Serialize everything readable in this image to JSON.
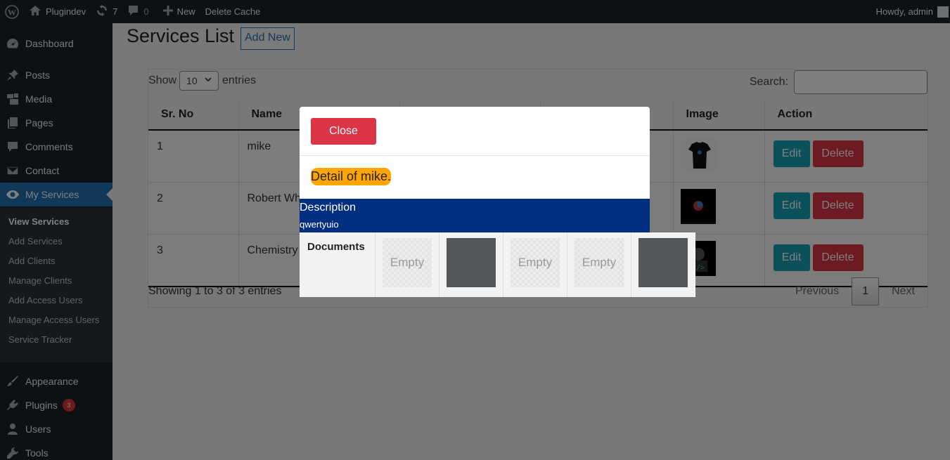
{
  "adminbar": {
    "site_name": "Plugindev",
    "updates_count": "7",
    "comments_count": "0",
    "new_label": "New",
    "delete_cache_label": "Delete Cache",
    "howdy": "Howdy, admin"
  },
  "sidebar": {
    "items": [
      {
        "label": "Dashboard",
        "icon": "dashboard-icon"
      },
      {
        "label": "Posts",
        "icon": "pin-icon"
      },
      {
        "label": "Media",
        "icon": "media-icon"
      },
      {
        "label": "Pages",
        "icon": "pages-icon"
      },
      {
        "label": "Comments",
        "icon": "comment-icon"
      },
      {
        "label": "Contact",
        "icon": "mail-icon"
      },
      {
        "label": "My Services",
        "icon": "eye-icon"
      }
    ],
    "submenu": [
      "View Services",
      "Add Services",
      "Add Clients",
      "Manage Clients",
      "Add Access Users",
      "Manage Access Users",
      "Service Tracker"
    ],
    "lower_items": [
      {
        "label": "Appearance",
        "icon": "brush-icon"
      },
      {
        "label": "Plugins",
        "icon": "plugin-icon",
        "badge": "3"
      },
      {
        "label": "Users",
        "icon": "user-icon"
      },
      {
        "label": "Tools",
        "icon": "wrench-icon"
      }
    ]
  },
  "page": {
    "title": "Services List",
    "add_new_label": "Add New",
    "show_label": "Show",
    "entries_label": "entries",
    "page_length": "10",
    "search_label": "Search:",
    "search_value": ""
  },
  "table": {
    "headers": [
      "Sr. No",
      "Name",
      "",
      "",
      "Image",
      "Action"
    ],
    "rows": [
      {
        "sr": "1",
        "name": "mike"
      },
      {
        "sr": "2",
        "name": "Robert Wh"
      },
      {
        "sr": "3",
        "name": "Chemistry"
      }
    ],
    "edit_label": "Edit",
    "delete_label": "Delete",
    "info": "Showing 1 to 3 of 3 entries",
    "previous_label": "Previous",
    "current_page": "1",
    "next_label": "Next"
  },
  "modal": {
    "close_label": "Close",
    "title": "Detail of mike.",
    "description_label": "Description",
    "description_value": "qwertyuio",
    "documents_label": "Documents",
    "empty_label": "Empty"
  },
  "colors": {
    "admin_bg": "#1d2327",
    "accent": "#2271b1",
    "danger": "#dc3545",
    "info": "#17a2b8",
    "modal_title_bg": "#ffa500",
    "description_bg": "#002e80"
  }
}
